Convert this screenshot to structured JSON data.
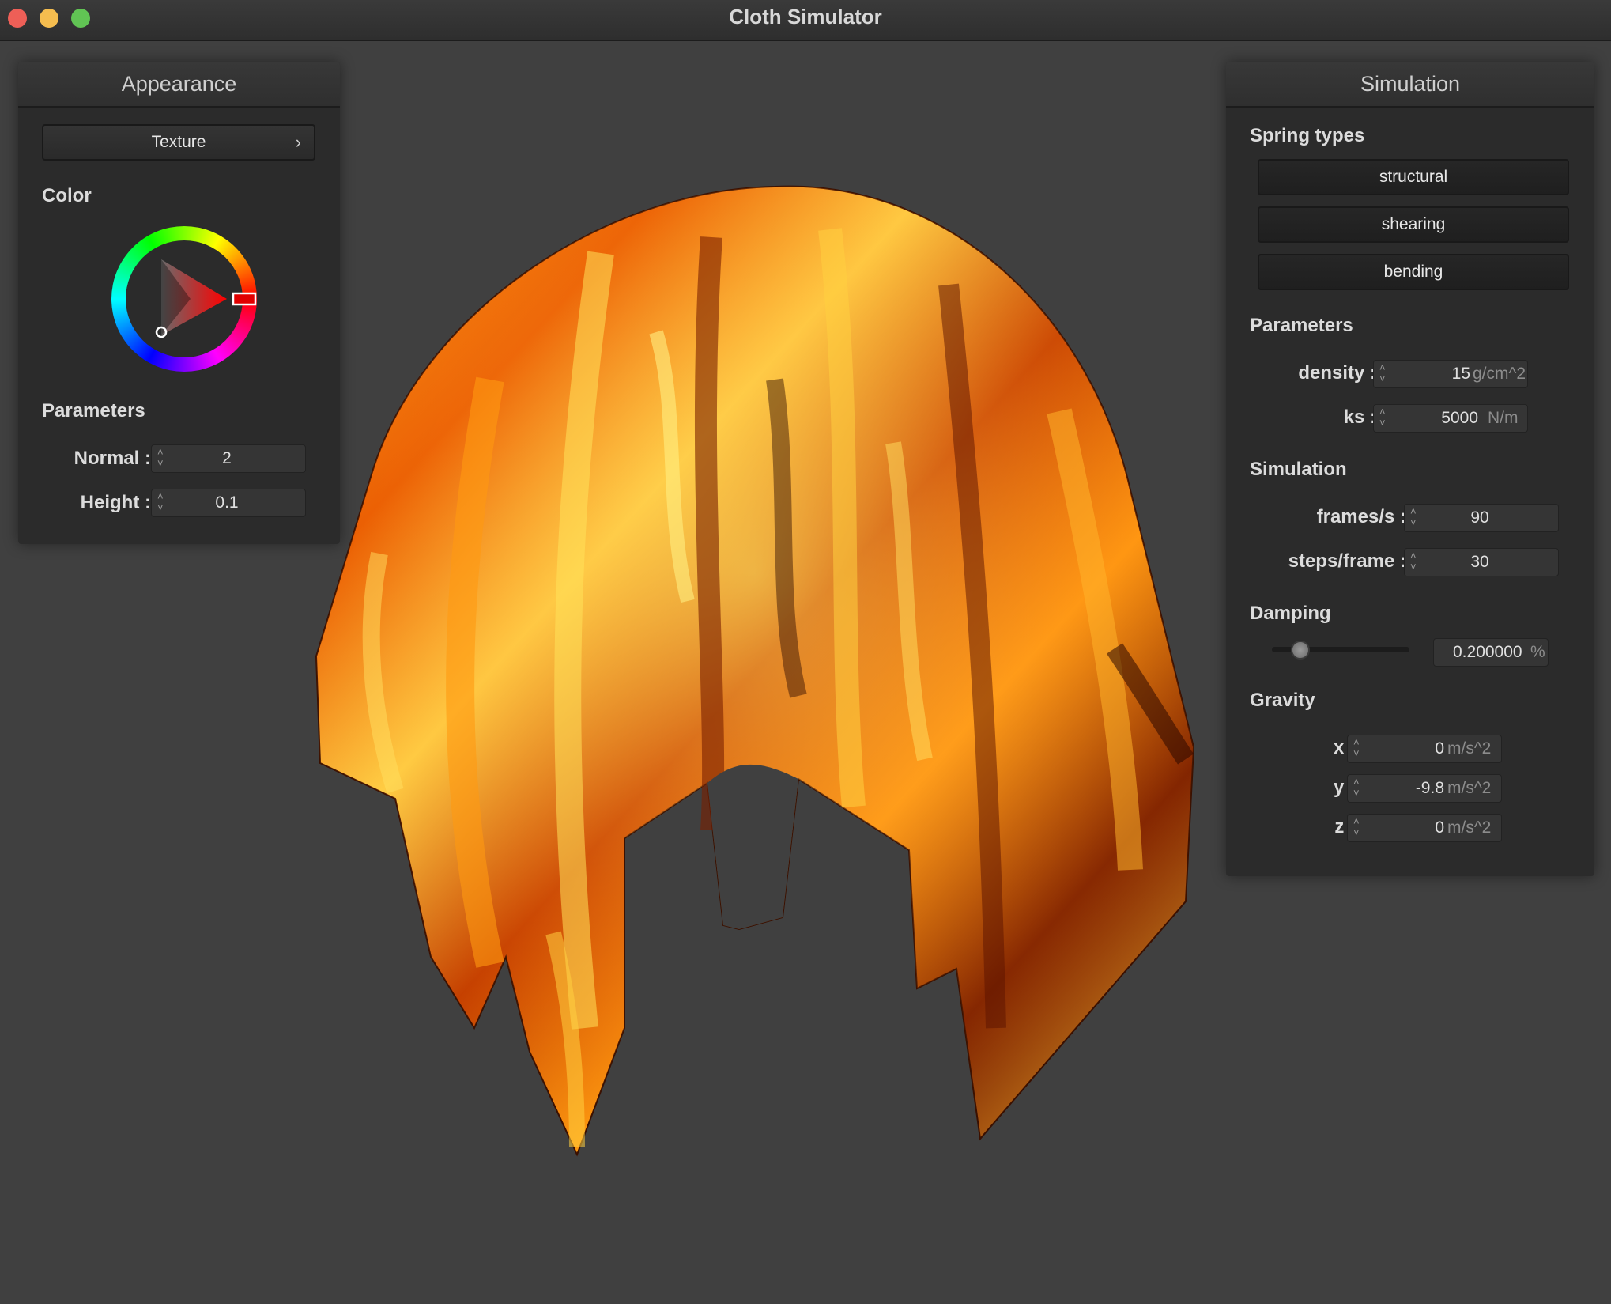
{
  "window": {
    "title": "Cloth Simulator"
  },
  "appearance": {
    "header": "Appearance",
    "texture_button": "Texture",
    "color_label": "Color",
    "parameters_label": "Parameters",
    "normal": {
      "label": "Normal :",
      "value": "2"
    },
    "height": {
      "label": "Height :",
      "value": "0.1"
    }
  },
  "simulation": {
    "header": "Simulation",
    "spring_types_label": "Spring types",
    "springs": [
      "structural",
      "shearing",
      "bending"
    ],
    "parameters_label": "Parameters",
    "density": {
      "label": "density :",
      "value": "15",
      "unit": "g/cm^2"
    },
    "ks": {
      "label": "ks :",
      "value": "5000",
      "unit": "N/m"
    },
    "simulation_label": "Simulation",
    "fps": {
      "label": "frames/s :",
      "value": "90"
    },
    "steps": {
      "label": "steps/frame :",
      "value": "30"
    },
    "damping_label": "Damping",
    "damping": {
      "value": "0.200000",
      "unit": "%",
      "slider_fraction": 0.2
    },
    "gravity_label": "Gravity",
    "gravity": [
      {
        "label": "x :",
        "value": "0",
        "unit": "m/s^2"
      },
      {
        "label": "y :",
        "value": "-9.8",
        "unit": "m/s^2"
      },
      {
        "label": "z :",
        "value": "0",
        "unit": "m/s^2"
      }
    ]
  }
}
